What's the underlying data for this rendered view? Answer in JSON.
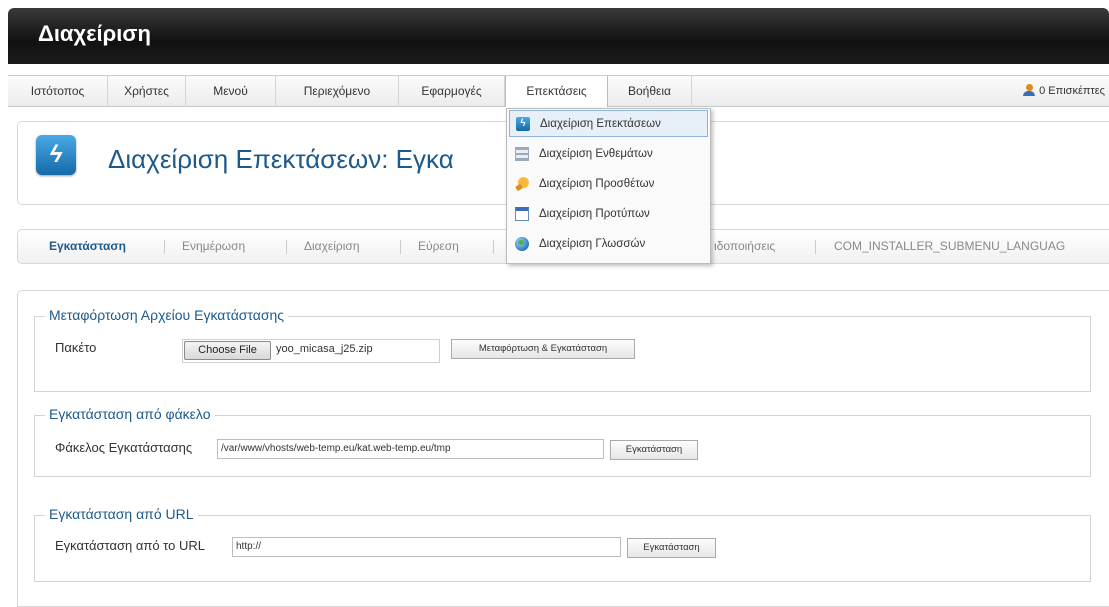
{
  "header": {
    "title": "Διαχείριση"
  },
  "menubar": {
    "items": [
      "Ιστότοπος",
      "Χρήστες",
      "Μενού",
      "Περιεχόμενο",
      "Εφαρμογές",
      "Επεκτάσεις",
      "Βοήθεια"
    ],
    "active": "Επεκτάσεις",
    "visitors": "0 Επισκέπτες"
  },
  "dropdown": {
    "items": [
      "Διαχείριση Επεκτάσεων",
      "Διαχείριση Ενθεμάτων",
      "Διαχείριση Προσθέτων",
      "Διαχείριση Προτύπων",
      "Διαχείριση Γλωσσών"
    ],
    "icons": [
      "extensions-icon",
      "modules-icon",
      "plugins-icon",
      "templates-icon",
      "languages-icon"
    ],
    "highlighted": "Διαχείριση Επεκτάσεων"
  },
  "page": {
    "title": "Διαχείριση Επεκτάσεων: Εγκα",
    "accent_color": "#1d5a8c"
  },
  "submenu": {
    "tabs": [
      "Εγκατάσταση",
      "Ενημέρωση",
      "Διαχείριση",
      "Εύρεση",
      "ιδοποιήσεις",
      "COM_INSTALLER_SUBMENU_LANGUAG"
    ],
    "active": "Εγκατάσταση"
  },
  "upload": {
    "legend": "Μεταφόρτωση Αρχείου Εγκατάστασης",
    "label": "Πακέτο",
    "choose_label": "Choose File",
    "file_name": "yoo_micasa_j25.zip",
    "button": "Μεταφόρτωση & Εγκατάσταση"
  },
  "folder": {
    "legend": "Εγκατάσταση από φάκελο",
    "label": "Φάκελος Εγκατάστασης",
    "value": "/var/www/vhosts/web-temp.eu/kat.web-temp.eu/tmp",
    "button": "Εγκατάσταση"
  },
  "url": {
    "legend": "Εγκατάσταση από URL",
    "label": "Εγκατάσταση από το URL",
    "value": "http://",
    "button": "Εγκατάσταση"
  }
}
